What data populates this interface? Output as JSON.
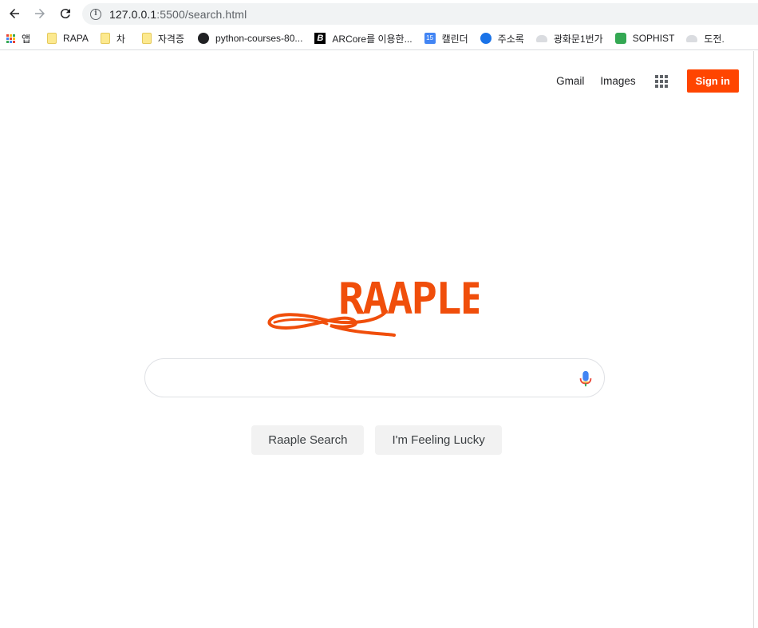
{
  "browser": {
    "url_host": "127.0.0.1",
    "url_rest": ":5500/search.html",
    "bookmarks": [
      {
        "label": "앱",
        "icon": "apps-icon"
      },
      {
        "label": "RAPA",
        "icon": "folder-icon"
      },
      {
        "label": "차",
        "icon": "folder-icon"
      },
      {
        "label": "자격증",
        "icon": "folder-icon"
      },
      {
        "label": "python-courses-80...",
        "icon": "globe-icon"
      },
      {
        "label": "ARCore를 이용한...",
        "icon": "arcore-icon"
      },
      {
        "label": "캘린더",
        "icon": "calendar-icon",
        "badge": "15"
      },
      {
        "label": "주소록",
        "icon": "contacts-icon"
      },
      {
        "label": "광화문1번가",
        "icon": "cloud-icon"
      },
      {
        "label": "SOPHIST",
        "icon": "sophist-icon"
      },
      {
        "label": "도전.",
        "icon": "cloud-icon"
      }
    ]
  },
  "header": {
    "gmail": "Gmail",
    "images": "Images",
    "signin": "Sign in",
    "accent": "#ff4500"
  },
  "logo": {
    "text": "RAAPLE",
    "color": "#f04e0b"
  },
  "search": {
    "value": "",
    "placeholder": ""
  },
  "buttons": {
    "search": "Raaple Search",
    "lucky": "I'm Feeling Lucky"
  }
}
